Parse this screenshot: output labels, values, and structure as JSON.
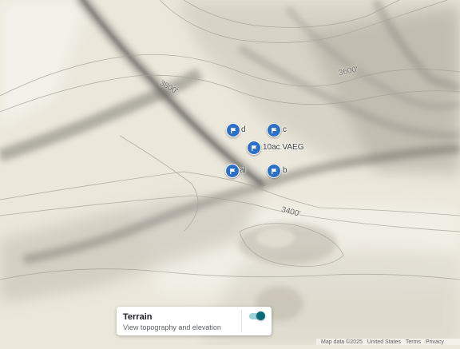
{
  "map": {
    "markers": [
      {
        "label": "d"
      },
      {
        "label": "c"
      },
      {
        "label": "10ac VAEG"
      },
      {
        "label": "ai"
      },
      {
        "label": "b"
      }
    ],
    "contour_labels": [
      "3800'",
      "3600'",
      "3400'"
    ],
    "marker_color": "#2d6fc4",
    "marker_icon": "flag-icon"
  },
  "layer_card": {
    "title": "Terrain",
    "subtitle": "View topography and elevation",
    "toggle_on": true,
    "accent_color": "#0b6b77"
  },
  "footer": {
    "attribution": "Map data ©2025",
    "region": "United States",
    "terms": "Terms",
    "privacy": "Privacy"
  }
}
